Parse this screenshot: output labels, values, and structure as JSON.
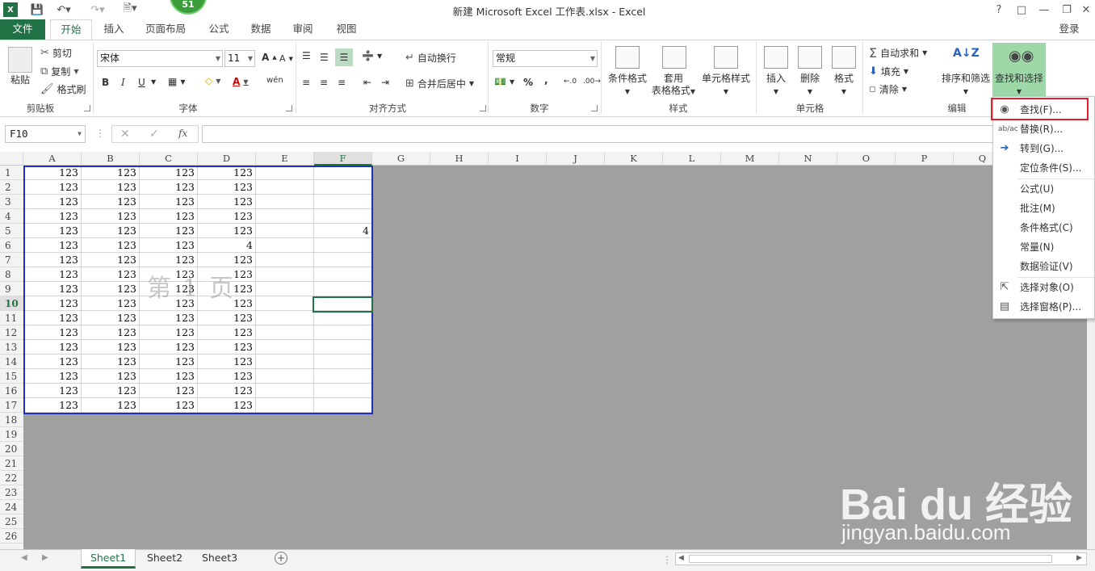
{
  "titlebar": {
    "title": "新建 Microsoft Excel 工作表.xlsx - Excel",
    "badge": "51",
    "help": "?",
    "signin": "登录"
  },
  "tabs": {
    "file": "文件",
    "home": "开始",
    "insert": "插入",
    "layout": "页面布局",
    "formulas": "公式",
    "data": "数据",
    "review": "审阅",
    "view": "视图"
  },
  "clipboard": {
    "paste": "粘贴",
    "cut": "剪切",
    "copy": "复制",
    "format_painter": "格式刷",
    "group": "剪贴板"
  },
  "font": {
    "name": "宋体",
    "size": "11",
    "bold": "B",
    "italic": "I",
    "underline": "U",
    "wen": "wén",
    "group": "字体"
  },
  "alignment": {
    "wrap": "自动换行",
    "merge": "合并后居中",
    "group": "对齐方式"
  },
  "number": {
    "format": "常规",
    "percent": "%",
    "comma": ",",
    "group": "数字"
  },
  "styles": {
    "conditional": "条件格式",
    "table1": "套用",
    "table2": "表格格式",
    "cell_styles": "单元格样式",
    "group": "样式"
  },
  "cells_group": {
    "insert": "插入",
    "delete": "删除",
    "format": "格式",
    "group": "单元格"
  },
  "editing": {
    "autosum": "自动求和",
    "fill": "填充",
    "clear": "清除",
    "sort": "排序和筛选",
    "find": "查找和选择",
    "group": "编辑"
  },
  "formula_bar": {
    "name_box": "F10",
    "fx": "fx",
    "value": ""
  },
  "columns": [
    "A",
    "B",
    "C",
    "D",
    "E",
    "F",
    "G",
    "H",
    "I",
    "J",
    "K",
    "L",
    "M",
    "N",
    "O",
    "P",
    "Q"
  ],
  "rows": [
    "1",
    "2",
    "3",
    "4",
    "5",
    "6",
    "7",
    "8",
    "9",
    "10",
    "11",
    "12",
    "13",
    "14",
    "15",
    "16",
    "17",
    "18",
    "19",
    "20",
    "21",
    "22",
    "23",
    "24",
    "25",
    "26"
  ],
  "grid": [
    [
      "123",
      "123",
      "123",
      "123",
      "",
      ""
    ],
    [
      "123",
      "123",
      "123",
      "123",
      "",
      ""
    ],
    [
      "123",
      "123",
      "123",
      "123",
      "",
      ""
    ],
    [
      "123",
      "123",
      "123",
      "123",
      "",
      ""
    ],
    [
      "123",
      "123",
      "123",
      "123",
      "",
      "4"
    ],
    [
      "123",
      "123",
      "123",
      "4",
      "",
      ""
    ],
    [
      "123",
      "123",
      "123",
      "123",
      "",
      ""
    ],
    [
      "123",
      "123",
      "123",
      "123",
      "",
      ""
    ],
    [
      "123",
      "123",
      "123",
      "123",
      "",
      ""
    ],
    [
      "123",
      "123",
      "123",
      "123",
      "",
      ""
    ],
    [
      "123",
      "123",
      "123",
      "123",
      "",
      ""
    ],
    [
      "123",
      "123",
      "123",
      "123",
      "",
      ""
    ],
    [
      "123",
      "123",
      "123",
      "123",
      "",
      ""
    ],
    [
      "123",
      "123",
      "123",
      "123",
      "",
      ""
    ],
    [
      "123",
      "123",
      "123",
      "123",
      "",
      ""
    ],
    [
      "123",
      "123",
      "123",
      "123",
      "",
      ""
    ],
    [
      "123",
      "123",
      "123",
      "123",
      "",
      ""
    ]
  ],
  "page_watermark": "第1页",
  "sheets": [
    "Sheet1",
    "Sheet2",
    "Sheet3"
  ],
  "menu": {
    "find": "查找(F)...",
    "replace": "替换(R)...",
    "goto": "转到(G)...",
    "goto_special": "定位条件(S)...",
    "formulas": "公式(U)",
    "comments": "批注(M)",
    "conditional": "条件格式(C)",
    "constants": "常量(N)",
    "validation": "数据验证(V)",
    "select_objects": "选择对象(O)",
    "selection_pane": "选择窗格(P)..."
  },
  "baidu": {
    "logo": "Bai du 经验",
    "url": "jingyan.baidu.com"
  },
  "colors": {
    "excel_green": "#217346",
    "highlight_red": "#e0212b",
    "print_border": "#1f2fbf"
  }
}
